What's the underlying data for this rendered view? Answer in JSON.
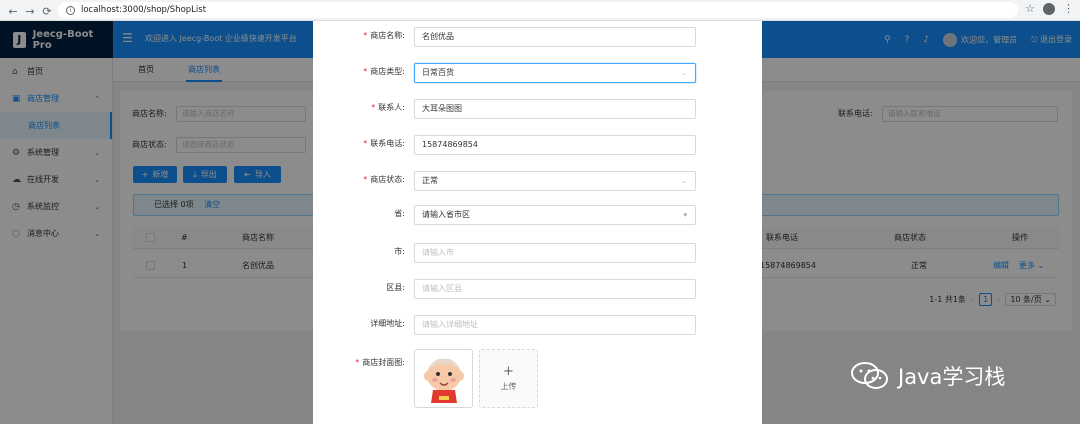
{
  "browser": {
    "url": "localhost:3000/shop/ShopList"
  },
  "header": {
    "logo_letter": "J",
    "app_title": "Jeecg-Boot Pro",
    "welcome": "欢迎进入 Jeecg-Boot 企业级快速开发平台",
    "user_greeting": "欢迎您，管理员",
    "logout": "退出登录"
  },
  "sidebar": {
    "items": [
      {
        "label": "首页",
        "icon": "home-icon"
      },
      {
        "label": "商店管理",
        "icon": "shop-icon"
      },
      {
        "label": "商店列表"
      },
      {
        "label": "系统管理",
        "icon": "setting-icon"
      },
      {
        "label": "在线开发",
        "icon": "cloud-icon"
      },
      {
        "label": "系统监控",
        "icon": "dashboard-icon"
      },
      {
        "label": "消息中心",
        "icon": "message-icon"
      }
    ]
  },
  "tabs": [
    {
      "label": "首页"
    },
    {
      "label": "商店列表"
    }
  ],
  "search": {
    "name_label": "商店名称:",
    "name_placeholder": "请输入商店名称",
    "phone_label": "联系电话:",
    "phone_placeholder": "请输入联系电话",
    "status_label": "商店状态:",
    "status_placeholder": "请选择商店状态"
  },
  "toolbar": {
    "add": "新增",
    "export": "导出",
    "import": "导入"
  },
  "alert": {
    "selected": "已选择 0项",
    "clear": "清空"
  },
  "table": {
    "headers": [
      "#",
      "商店名称",
      "联系电话",
      "商店状态",
      "操作"
    ],
    "rows": [
      {
        "index": "1",
        "name": "名创优品",
        "phone": "15874869854",
        "status": "正常",
        "edit": "编辑",
        "more": "更多"
      }
    ]
  },
  "pagination": {
    "summary": "1-1 共1条",
    "current": "1",
    "page_size": "10 条/页"
  },
  "form": {
    "fields": [
      {
        "label": "商店名称",
        "value": "名创优品",
        "required": true
      },
      {
        "label": "商店类型",
        "value": "日常百货",
        "required": true
      },
      {
        "label": "联系人",
        "value": "大耳朵图图",
        "required": true
      },
      {
        "label": "联系电话",
        "value": "15874869854",
        "required": true
      },
      {
        "label": "商店状态",
        "value": "正常",
        "required": true
      },
      {
        "label": "省",
        "value": "请输入省市区",
        "required": false
      },
      {
        "label": "市",
        "placeholder": "请输入市",
        "required": false
      },
      {
        "label": "区县",
        "placeholder": "请输入区县",
        "required": false
      },
      {
        "label": "详细地址",
        "placeholder": "请输入详细地址",
        "required": false
      },
      {
        "label": "商店封面图",
        "required": true
      }
    ],
    "upload_label": "上传"
  },
  "watermark": {
    "text": "Java学习栈"
  },
  "colors": {
    "primary": "#1890ff",
    "logo_bg": "#002140",
    "required": "#f5222d"
  }
}
